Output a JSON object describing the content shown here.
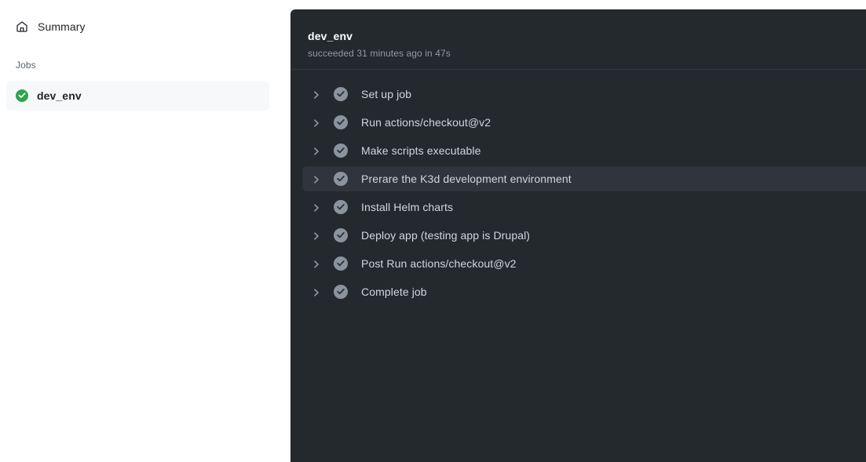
{
  "colors": {
    "page_background": "#ffffff",
    "panel_background": "#24292e",
    "panel_divider": "#32383f",
    "active_step_background": "#2f343d",
    "sidebar_selected_background": "#f6f8fa",
    "success_green": "#2da44e",
    "step_check_gray": "#8b949e",
    "primary_text": "#1f2328",
    "muted_text": "#59636e",
    "panel_text": "#d0d7de",
    "panel_muted_text": "#9198a1"
  },
  "sidebar": {
    "summary": {
      "label": "Summary",
      "icon": "home-icon"
    },
    "jobs_heading": "Jobs",
    "jobs": [
      {
        "label": "dev_env",
        "status": "success",
        "icon": "check-circle-fill-icon",
        "selected": true
      }
    ]
  },
  "log_panel": {
    "title": "dev_env",
    "subtitle": "succeeded 31 minutes ago in 47s",
    "steps": [
      {
        "label": "Set up job",
        "status": "success",
        "expand_icon": "chevron-right-icon",
        "status_icon": "check-circle-fill-icon",
        "active": false
      },
      {
        "label": "Run actions/checkout@v2",
        "status": "success",
        "expand_icon": "chevron-right-icon",
        "status_icon": "check-circle-fill-icon",
        "active": false
      },
      {
        "label": "Make scripts executable",
        "status": "success",
        "expand_icon": "chevron-right-icon",
        "status_icon": "check-circle-fill-icon",
        "active": false
      },
      {
        "label": "Prerare the K3d development environment",
        "status": "success",
        "expand_icon": "chevron-right-icon",
        "status_icon": "check-circle-fill-icon",
        "active": true
      },
      {
        "label": "Install Helm charts",
        "status": "success",
        "expand_icon": "chevron-right-icon",
        "status_icon": "check-circle-fill-icon",
        "active": false
      },
      {
        "label": "Deploy app (testing app is Drupal)",
        "status": "success",
        "expand_icon": "chevron-right-icon",
        "status_icon": "check-circle-fill-icon",
        "active": false
      },
      {
        "label": "Post Run actions/checkout@v2",
        "status": "success",
        "expand_icon": "chevron-right-icon",
        "status_icon": "check-circle-fill-icon",
        "active": false
      },
      {
        "label": "Complete job",
        "status": "success",
        "expand_icon": "chevron-right-icon",
        "status_icon": "check-circle-fill-icon",
        "active": false
      }
    ]
  }
}
